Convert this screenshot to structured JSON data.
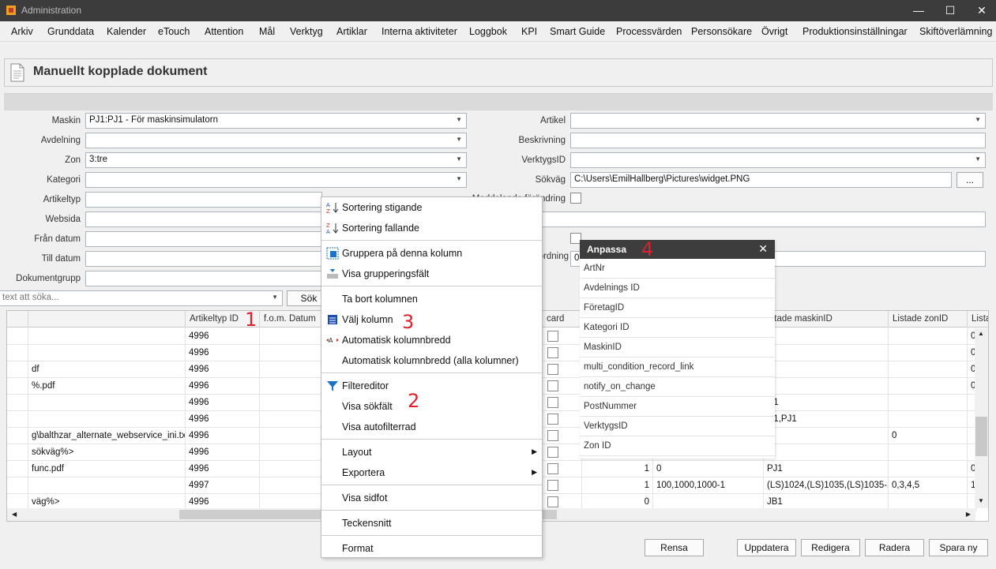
{
  "window": {
    "title": "Administration"
  },
  "menu": [
    "Arkiv",
    "Grunddata",
    "Kalender",
    "eTouch",
    "Attention",
    "Mål",
    "Verktyg",
    "Artiklar",
    "Interna aktiviteter",
    "Loggbok",
    "KPI",
    "Smart Guide",
    "Processvärden",
    "Personsökare",
    "Övrigt",
    "Produktionsinställningar",
    "Skiftöverlämning"
  ],
  "page": {
    "title": "Manuellt kopplade dokument"
  },
  "form": {
    "maskin": {
      "label": "Maskin",
      "value": "PJ1:PJ1 - För maskinsimulatorn"
    },
    "avdelning": {
      "label": "Avdelning",
      "value": ""
    },
    "zon": {
      "label": "Zon",
      "value": "3:tre"
    },
    "kategori": {
      "label": "Kategori",
      "value": ""
    },
    "artikeltyp": {
      "label": "Artikeltyp"
    },
    "websida": {
      "label": "Websida"
    },
    "fran_datum": {
      "label": "Från datum"
    },
    "till_datum": {
      "label": "Till datum"
    },
    "dokumentgrupp": {
      "label": "Dokumentgrupp"
    },
    "artikel": {
      "label": "Artikel",
      "value": ""
    },
    "beskrivning": {
      "label": "Beskrivning",
      "value": ""
    },
    "verktygsid": {
      "label": "VerktygsID",
      "value": ""
    },
    "sokvag": {
      "label": "Sökväg",
      "value": "C:\\Users\\EmilHallberg\\Pictures\\widget.PNG",
      "browse": "..."
    },
    "partial_label_1": "Meddelande förändring",
    "partial_label_2": "ordning",
    "partial_value_2": "0"
  },
  "search": {
    "placeholder": "text att söka...",
    "button": "Sök"
  },
  "grid": {
    "headers": {
      "artikeltyp_id": "Artikeltyp ID",
      "fom_datum": "f.o.m. Datum",
      "card": "card",
      "listade_maskinid": "istade maskinID",
      "listade_zonid": "Listade zonID",
      "lista": "Lista"
    },
    "rows": [
      {
        "c1": "",
        "artikeltyp": "4996",
        "num": "",
        "val": "",
        "maskin": "1",
        "zon": "",
        "last": "0"
      },
      {
        "c1": "",
        "artikeltyp": "4996",
        "num": "",
        "val": "",
        "maskin": "1",
        "zon": "",
        "last": "0"
      },
      {
        "c1": "df",
        "artikeltyp": "4996",
        "num": "",
        "val": "",
        "maskin": "1",
        "zon": "",
        "last": "0"
      },
      {
        "c1": "%.pdf",
        "artikeltyp": "4996",
        "num": "",
        "val": "",
        "maskin": "1",
        "zon": "",
        "last": "0"
      },
      {
        "c1": "",
        "artikeltyp": "4996",
        "num": "",
        "val": "",
        "maskin": "C1",
        "zon": "",
        "last": ""
      },
      {
        "c1": "",
        "artikeltyp": "4996",
        "num": "",
        "val": "",
        "maskin": "C1,PJ1",
        "zon": "",
        "last": ""
      },
      {
        "c1": "g\\balthzar_alternate_webservice_ini.txt",
        "artikeltyp": "4996",
        "num": "",
        "val": "",
        "maskin": "",
        "zon": "0",
        "last": ""
      },
      {
        "c1": "sökväg%>",
        "artikeltyp": "4996",
        "num": "",
        "val": "",
        "maskin": "1",
        "zon": "",
        "last": ""
      },
      {
        "c1": "func.pdf",
        "artikeltyp": "4996",
        "num": "1",
        "val": "0",
        "maskin": "PJ1",
        "zon": "",
        "last": "0"
      },
      {
        "c1": "",
        "artikeltyp": "4997",
        "num": "1",
        "val": "100,1000,1000-1",
        "maskin": "(LS)1024,(LS)1035,(LS)1035-2",
        "zon": "0,3,4,5",
        "last": "1"
      },
      {
        "c1": "väg%>",
        "artikeltyp": "4996",
        "num": "0",
        "val": "",
        "maskin": "JB1",
        "zon": "",
        "last": ""
      }
    ]
  },
  "context_menu": [
    {
      "label": "Sortering stigande",
      "icon": "sort-ascending-icon"
    },
    {
      "label": "Sortering fallande",
      "icon": "sort-descending-icon"
    },
    {
      "label": "Gruppera på denna kolumn",
      "icon": "group-by-column-icon"
    },
    {
      "label": "Visa grupperingsfält",
      "icon": "group-panel-icon"
    },
    {
      "label": "Ta bort kolumnen",
      "icon": ""
    },
    {
      "label": "Välj kolumn",
      "icon": "column-chooser-icon"
    },
    {
      "label": "Automatisk kolumnbredd",
      "icon": "best-fit-icon"
    },
    {
      "label": "Automatisk kolumnbredd (alla kolumner)",
      "icon": ""
    },
    {
      "label": "Filtereditor",
      "icon": "filter-icon"
    },
    {
      "label": "Visa sökfält",
      "icon": ""
    },
    {
      "label": "Visa autofilterrad",
      "icon": ""
    },
    {
      "label": "Layout",
      "icon": "",
      "submenu": true
    },
    {
      "label": "Exportera",
      "icon": "",
      "submenu": true
    },
    {
      "label": "Visa sidfot",
      "icon": ""
    },
    {
      "label": "Teckensnitt",
      "icon": ""
    },
    {
      "label": "Format",
      "icon": ""
    }
  ],
  "anpassa": {
    "title": "Anpassa",
    "items": [
      "ArtNr",
      "Avdelnings ID",
      "FöretagID",
      "Kategori ID",
      "MaskinID",
      "multi_condition_record_link",
      "notify_on_change",
      "PostNummer",
      "VerktygsID",
      "Zon ID"
    ]
  },
  "annotations": [
    "1",
    "2",
    "3",
    "4"
  ],
  "buttons": {
    "rensa": "Rensa",
    "uppdatera": "Uppdatera",
    "redigera": "Redigera",
    "radera": "Radera",
    "spara_ny": "Spara ny"
  },
  "colors": {
    "titlebar": "#3c3c3c",
    "annotation": "#e0202a",
    "filter_icon": "#1a73c8"
  }
}
